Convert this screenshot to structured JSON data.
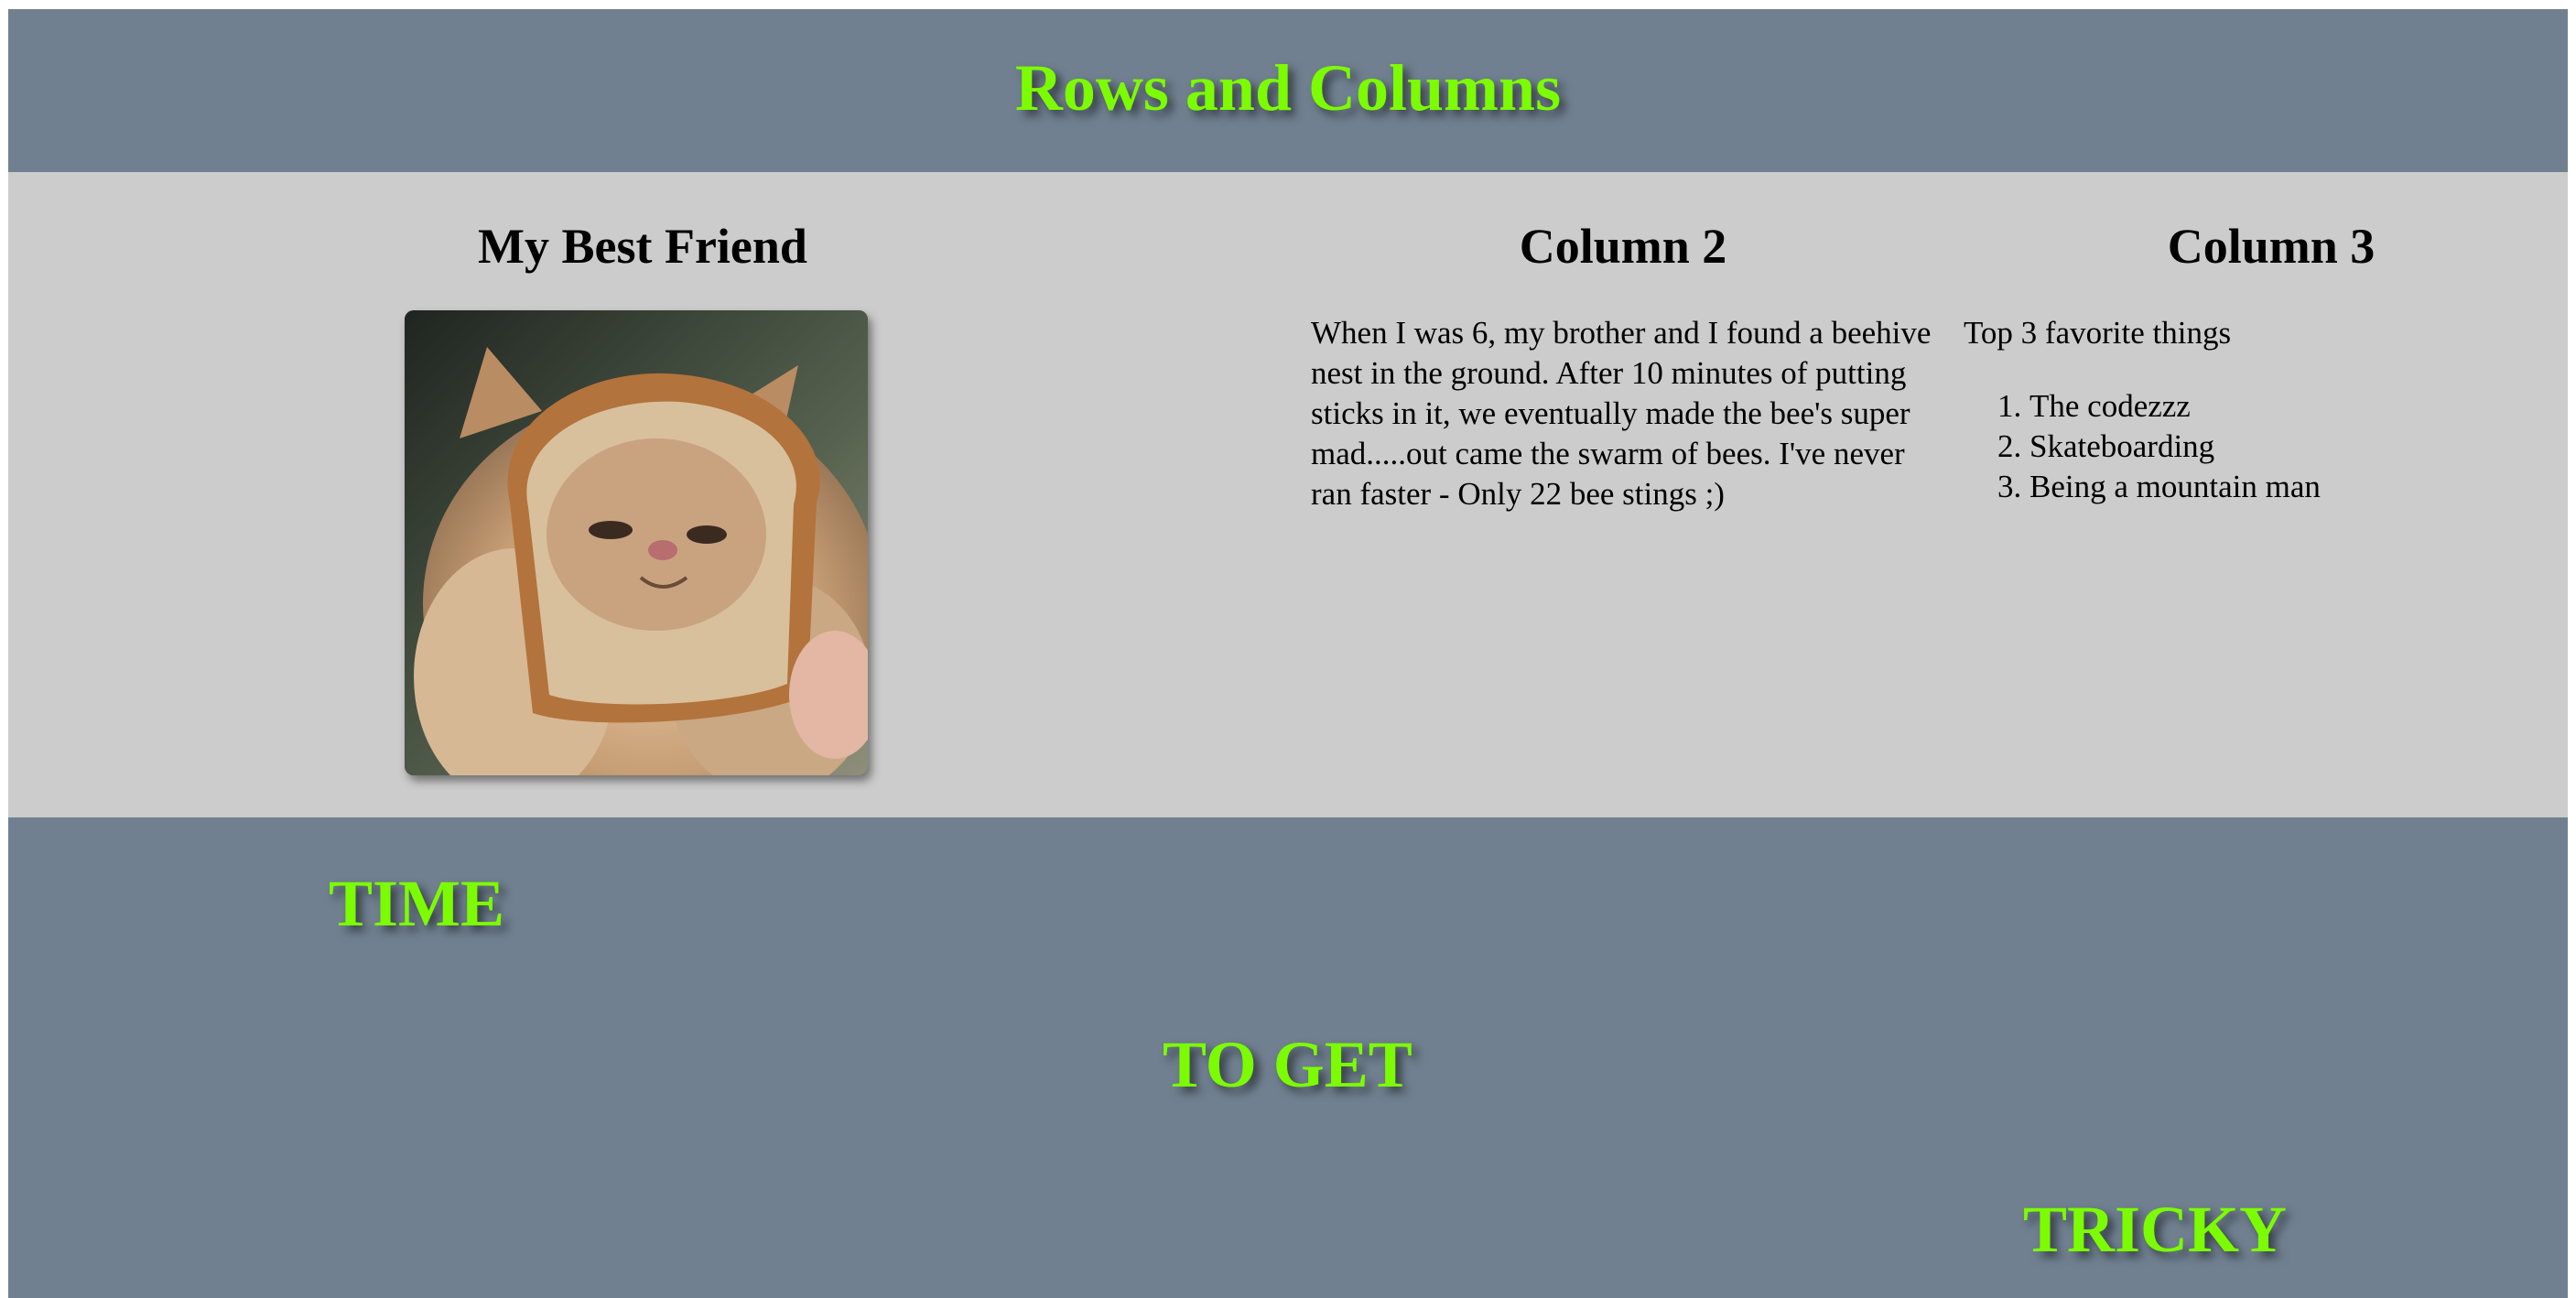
{
  "header": {
    "title": "Rows and Columns"
  },
  "columns": {
    "col1": {
      "title": "My Best Friend",
      "image": {
        "alt": "cat wearing a slice of bread"
      }
    },
    "col2": {
      "title": "Column 2",
      "text": "When I was 6, my brother and I found a beehive nest in the ground. After 10 minutes of putting sticks in it, we eventually made the bee's super mad.....out came the swarm of bees. I've never ran faster - Only 22 bee stings ;)"
    },
    "col3": {
      "title": "Column 3",
      "intro": "Top 3 favorite things",
      "items": [
        "The codezzz",
        "Skateboarding",
        "Being a mountain man"
      ]
    }
  },
  "footer": {
    "words": [
      "TIME",
      "TO GET",
      "TRICKY"
    ]
  },
  "colors": {
    "header_bg": "#708090",
    "row_bg": "#cccccc",
    "accent_text": "#7cfc00"
  }
}
